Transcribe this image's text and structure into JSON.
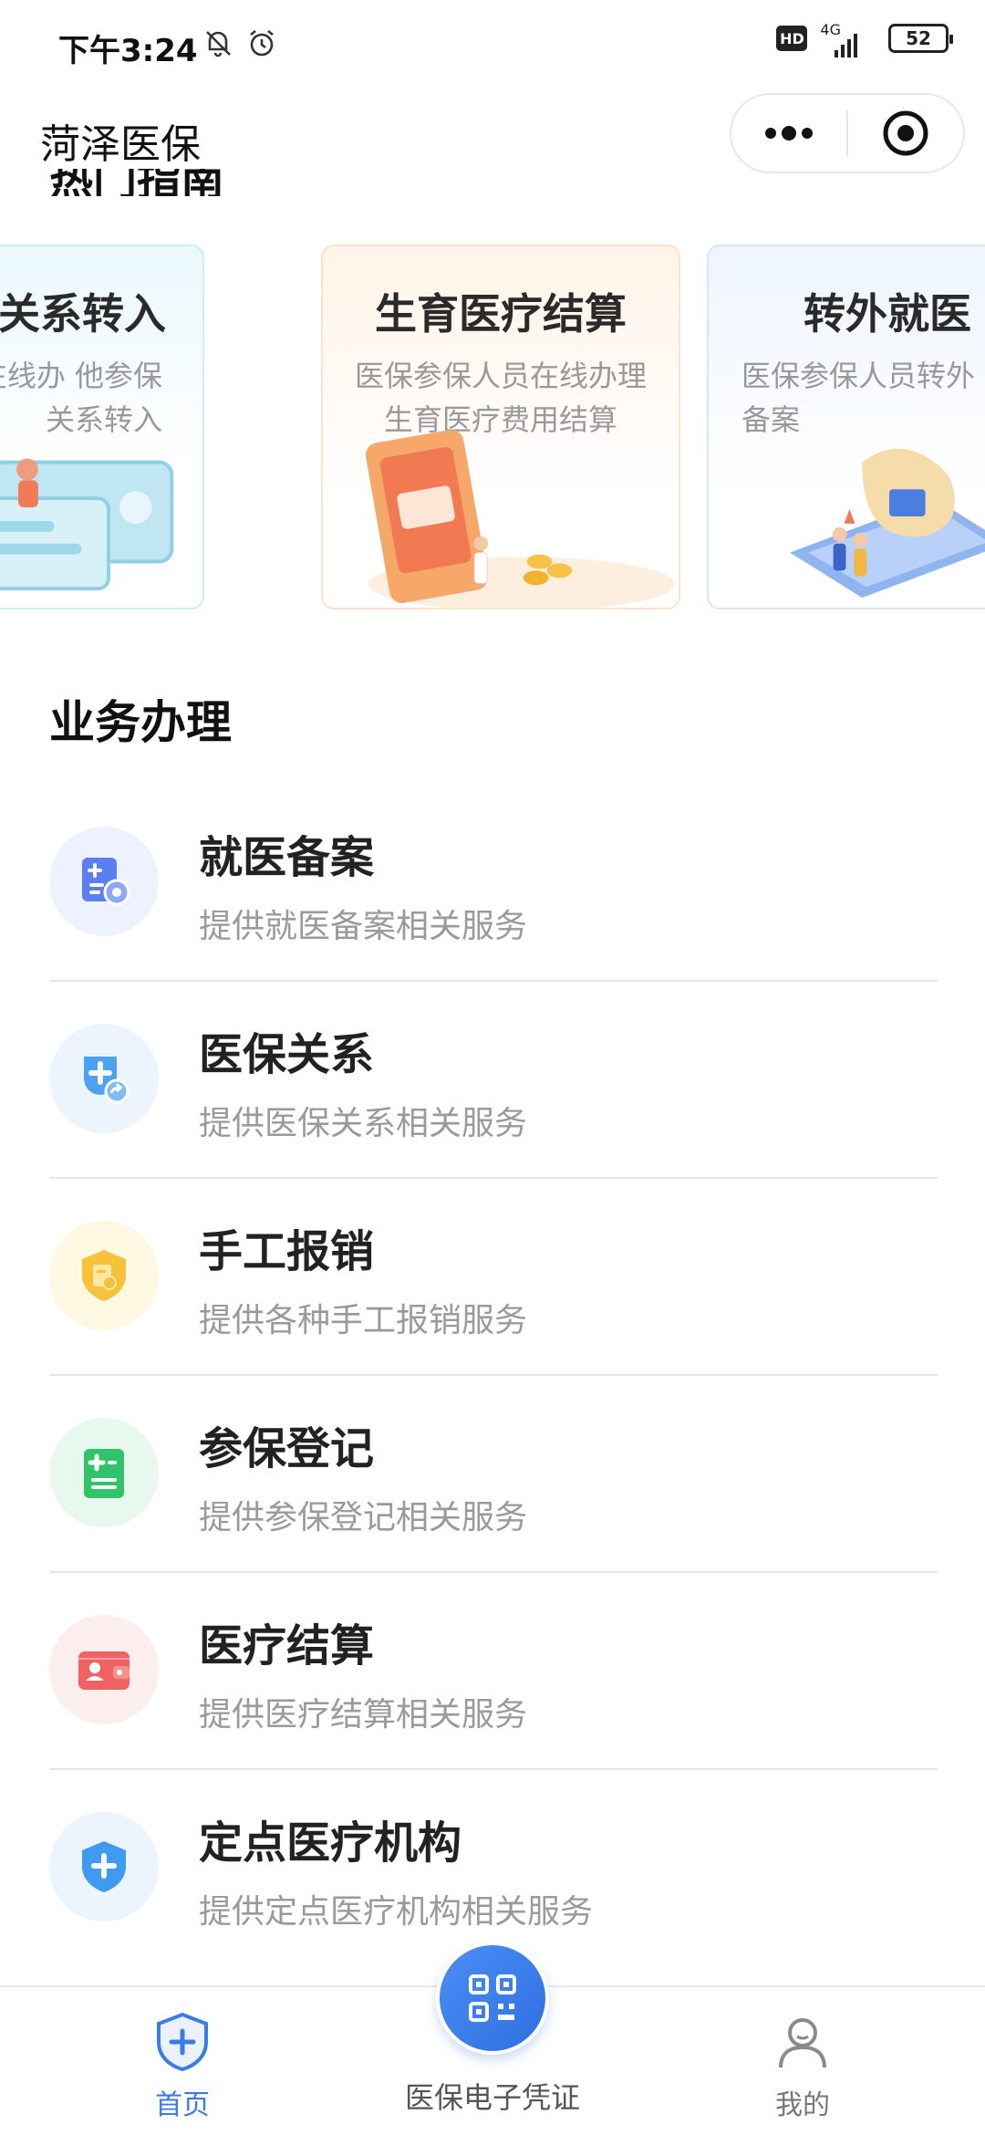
{
  "status_bar": {
    "time": "下午3:24",
    "hd": "HD",
    "network": "4G",
    "battery": "52"
  },
  "nav": {
    "title": "菏泽医保"
  },
  "hot_guide": {
    "title_partial": "热门指南",
    "cards": [
      {
        "title": "保关系转入",
        "desc": "参保人员在线办 他参保关系转入"
      },
      {
        "title": "生育医疗结算",
        "desc": "医保参保人员在线办理生育医疗费用结算"
      },
      {
        "title": "转外就医",
        "desc": "医保参保人员转外 疗备案"
      }
    ]
  },
  "business": {
    "title": "业务办理",
    "items": [
      {
        "name": "就医备案",
        "desc": "提供就医备案相关服务",
        "icon": "medical-record-icon",
        "bg": "#eef2fe",
        "color": "#5b7ff0"
      },
      {
        "name": "医保关系",
        "desc": "提供医保关系相关服务",
        "icon": "insurance-transfer-icon",
        "bg": "#ecf5fe",
        "color": "#4aa2f0"
      },
      {
        "name": "手工报销",
        "desc": "提供各种手工报销服务",
        "icon": "reimbursement-shield-icon",
        "bg": "#fff8e3",
        "color": "#f6c23a"
      },
      {
        "name": "参保登记",
        "desc": "提供参保登记相关服务",
        "icon": "registration-doc-icon",
        "bg": "#e8f8ee",
        "color": "#2fc46a"
      },
      {
        "name": "医疗结算",
        "desc": "提供医疗结算相关服务",
        "icon": "wallet-icon",
        "bg": "#fdeeee",
        "color": "#f06161"
      },
      {
        "name": "定点医疗机构",
        "desc": "提供定点医疗机构相关服务",
        "icon": "medical-shield-icon",
        "bg": "#ecf5fe",
        "color": "#3f9bf0"
      }
    ]
  },
  "tabbar": {
    "home": "首页",
    "qr": "医保电子凭证",
    "mine": "我的"
  },
  "colors": {
    "accent": "#3b7be8",
    "divider": "#e6e6e6"
  }
}
